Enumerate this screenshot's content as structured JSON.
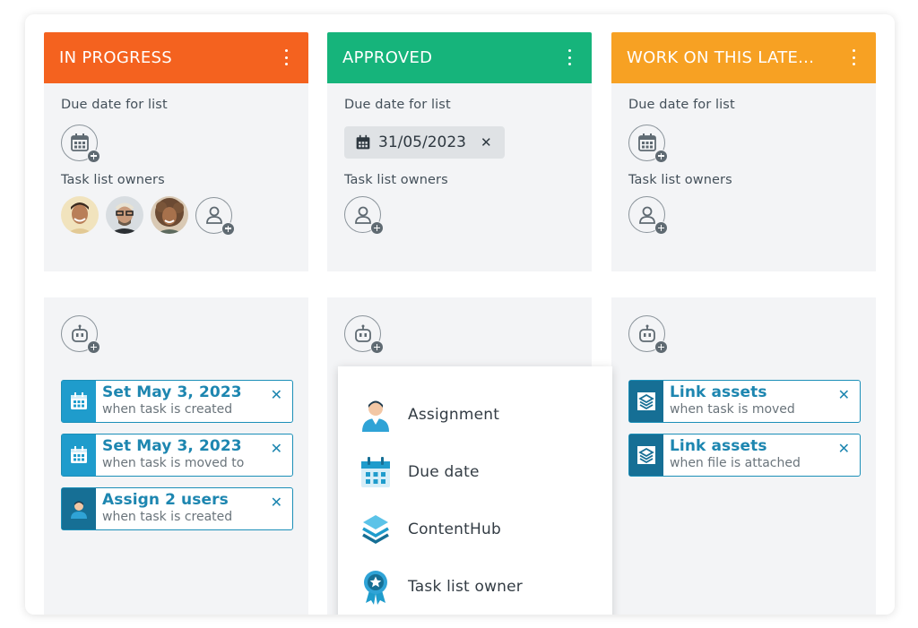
{
  "colors": {
    "in_progress": "#f4621f",
    "approved": "#16b47b",
    "later": "#f7a123",
    "accent": "#1f9ccc"
  },
  "columns": [
    {
      "title": "IN PROGRESS",
      "due_label": "Due date for list",
      "owners_label": "Task list owners",
      "rules": [
        {
          "title": "Set May 3, 2023",
          "subtitle": "when task is created",
          "icon": "calendar-icon"
        },
        {
          "title": "Set May 3, 2023",
          "subtitle": "when task is moved to",
          "icon": "calendar-icon"
        },
        {
          "title": "Assign 2 users",
          "subtitle": "when task is created",
          "icon": "user-icon"
        }
      ]
    },
    {
      "title": "APPROVED",
      "due_label": "Due date for list",
      "due_value": "31/05/2023",
      "owners_label": "Task list owners"
    },
    {
      "title": "WORK ON THIS LATE...",
      "due_label": "Due date for list",
      "owners_label": "Task list owners",
      "rules": [
        {
          "title": "Link assets",
          "subtitle": "when task is moved",
          "icon": "layers-icon"
        },
        {
          "title": "Link assets",
          "subtitle": "when file is attached",
          "icon": "layers-icon"
        }
      ]
    }
  ],
  "menu": {
    "items": [
      {
        "label": "Assignment",
        "icon": "person-icon"
      },
      {
        "label": "Due date",
        "icon": "calendar-icon"
      },
      {
        "label": "ContentHub",
        "icon": "layers-icon"
      },
      {
        "label": "Task list owner",
        "icon": "badge-icon"
      }
    ]
  }
}
